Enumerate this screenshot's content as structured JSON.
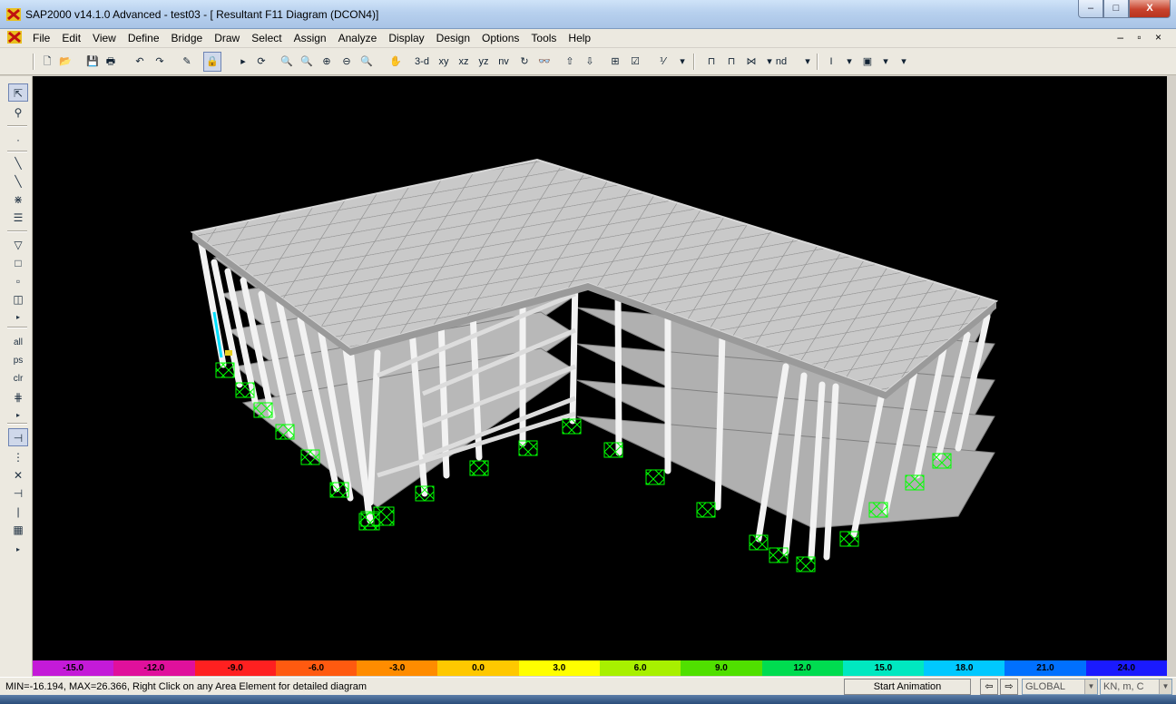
{
  "window": {
    "title": "SAP2000 v14.1.0 Advanced  - test03 - [  Resultant F11 Diagram   (DCON4)]",
    "minimize": "–",
    "maximize": "□",
    "close": "X"
  },
  "menu": {
    "items": [
      "File",
      "Edit",
      "View",
      "Define",
      "Bridge",
      "Draw",
      "Select",
      "Assign",
      "Analyze",
      "Display",
      "Design",
      "Options",
      "Tools",
      "Help"
    ],
    "mdi_controls": "– ̅̅̅ ×"
  },
  "toolbar": {
    "view_3d": "3-d",
    "view_xy": "xy",
    "view_xz": "xz",
    "view_yz": "yz",
    "view_nv": "nv",
    "nd": "nd"
  },
  "legend": {
    "values": [
      "-15.0",
      "-12.0",
      "-9.0",
      "-6.0",
      "-3.0",
      "0.0",
      "3.0",
      "6.0",
      "9.0",
      "12.0",
      "15.0",
      "18.0",
      "21.0",
      "24.0"
    ],
    "colors": [
      "#c41ad8",
      "#e0109c",
      "#ff2020",
      "#ff5a10",
      "#ff8c00",
      "#ffc800",
      "#ffff00",
      "#a8f000",
      "#50e000",
      "#00dc50",
      "#00e8c0",
      "#00c8ff",
      "#0070ff",
      "#1a1aff"
    ]
  },
  "status": {
    "text": "MIN=-16.194, MAX=26.366, Right Click on any Area Element for detailed diagram",
    "animation_button": "Start Animation",
    "coord_system": "GLOBAL",
    "units": "KN, m, C"
  },
  "viewport": {
    "background": "#000000",
    "slab_color": "#c8c8c8",
    "column_color": "#e8e8e8",
    "support_color": "#00ff00"
  }
}
